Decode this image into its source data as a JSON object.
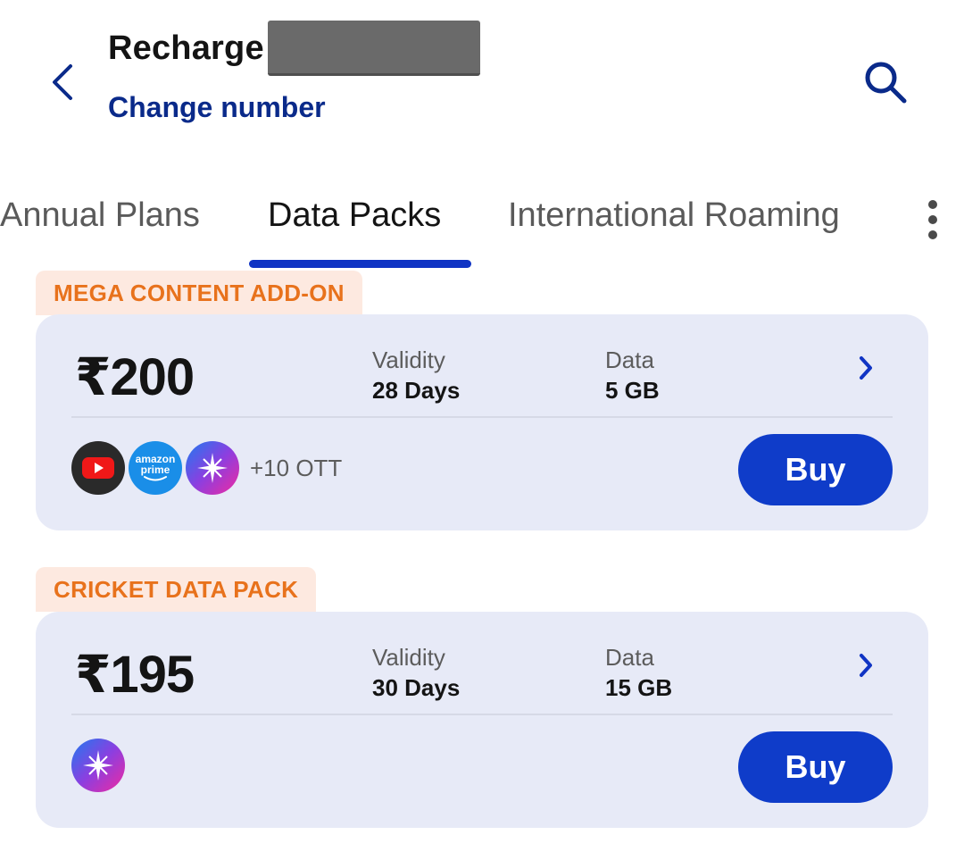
{
  "header": {
    "title": "Recharge",
    "change_number_label": "Change number"
  },
  "tabs": [
    {
      "label": "Annual Plans",
      "active": false
    },
    {
      "label": "Data Packs",
      "active": true
    },
    {
      "label": "International Roaming",
      "active": false
    }
  ],
  "plans": [
    {
      "badge": "MEGA CONTENT ADD-ON",
      "price": "₹200",
      "validity_label": "Validity",
      "validity_value": "28 Days",
      "data_label": "Data",
      "data_value": "5 GB",
      "ott_icons": [
        "youtube-icon",
        "amazon-prime-icon",
        "jiotv-star-icon"
      ],
      "prime_text_1": "amazon",
      "prime_text_2": "prime",
      "ott_more": "+10 OTT",
      "buy_label": "Buy"
    },
    {
      "badge": "CRICKET DATA PACK",
      "price": "₹195",
      "validity_label": "Validity",
      "validity_value": "30 Days",
      "data_label": "Data",
      "data_value": "15 GB",
      "ott_icons": [
        "jiotv-star-icon"
      ],
      "buy_label": "Buy"
    }
  ],
  "colors": {
    "accent": "#0f3cc9",
    "tab_indicator": "#1034c4",
    "badge_text": "#e8721c",
    "badge_bg": "#fde9e0",
    "card_bg": "#e7eaf7",
    "link": "#0a2a8a"
  }
}
